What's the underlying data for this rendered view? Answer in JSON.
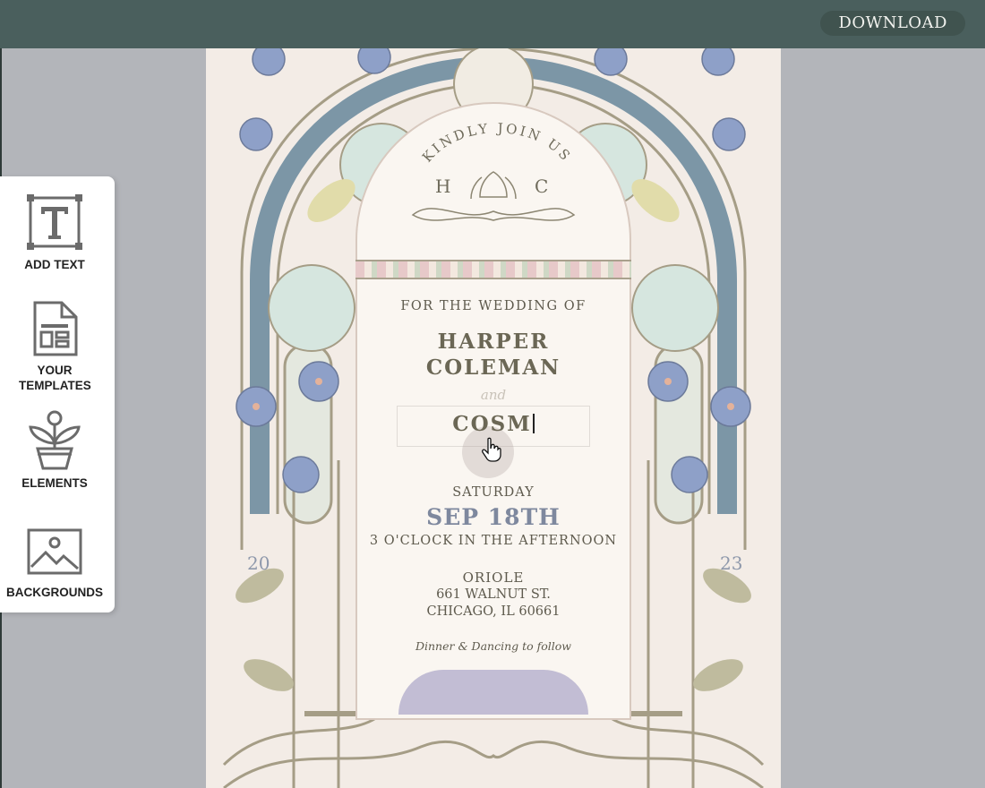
{
  "toolbar": {
    "download_label": "DOWNLOAD"
  },
  "sidebar": {
    "tools": [
      {
        "label": "ADD TEXT",
        "icon": "text-box-icon"
      },
      {
        "label": "YOUR TEMPLATES",
        "icon": "templates-icon"
      },
      {
        "label": "ELEMENTS",
        "icon": "plant-icon"
      },
      {
        "label": "BACKGROUNDS",
        "icon": "image-icon"
      }
    ]
  },
  "invitation": {
    "header": "KINDLY JOIN US",
    "monogram_left": "H",
    "monogram_right": "C",
    "intro": "FOR THE WEDDING OF",
    "partner1_line1": "HARPER",
    "partner1_line2": "COLEMAN",
    "and_text": "and",
    "partner2_editing": "COSM",
    "day": "SATURDAY",
    "date": "SEP 18TH",
    "time": "3 O'CLOCK IN THE AFTERNOON",
    "venue": "ORIOLE",
    "street": "661 WALNUT ST.",
    "city": "CHICAGO, IL 60661",
    "footer": "Dinner & Dancing to follow",
    "year_left": "20",
    "year_right": "23"
  },
  "colors": {
    "topbar": "#4a5f5d",
    "workspace": "#b3b5ba",
    "card": "#f3ece6",
    "text": "#5e5a4d",
    "accent_blue": "#8ea0c8"
  }
}
